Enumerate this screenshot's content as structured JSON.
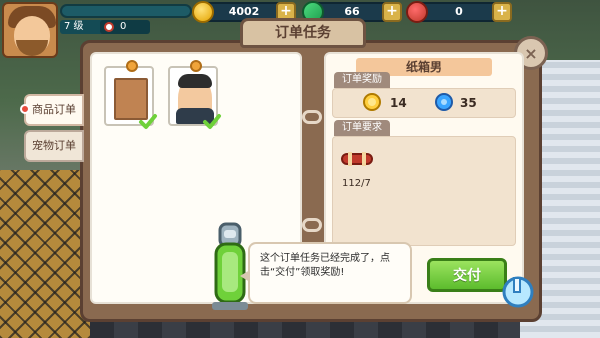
{
  "hud": {
    "level_label": "7 级",
    "hearts_count": "0",
    "coins": "4002",
    "gems": "66",
    "hearts": "0",
    "plus": "+"
  },
  "window": {
    "title": "订单任务",
    "close_label": "×"
  },
  "tabs": [
    {
      "label": "商品订单",
      "active": true
    },
    {
      "label": "宠物订单",
      "active": false
    }
  ],
  "order": {
    "customer_name": "纸箱男",
    "reward_label": "订单奖励",
    "reward_coins": "14",
    "reward_gems": "35",
    "requirement_label": "订单要求",
    "requirement_count": "112/7"
  },
  "tutorial": {
    "text": "这个订单任务已经完成了，点击“交付”领取奖励!"
  },
  "actions": {
    "deliver_label": "交付"
  }
}
